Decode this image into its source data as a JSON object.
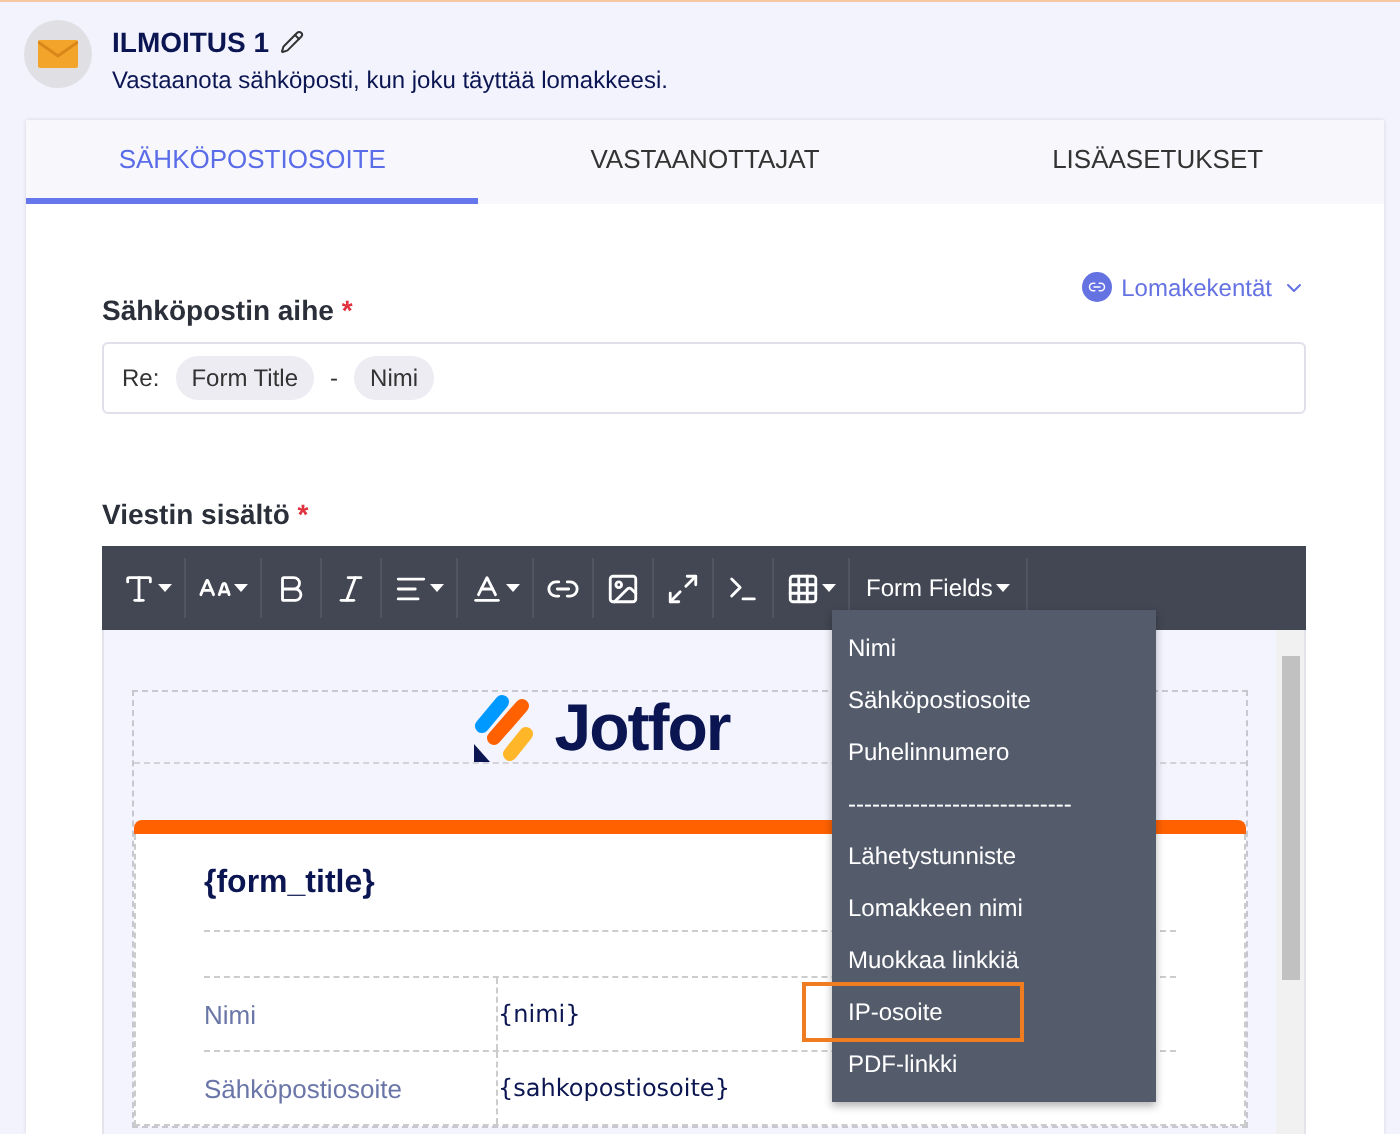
{
  "header": {
    "title": "ILMOITUS 1",
    "subtitle": "Vastaanota sähköposti, kun joku täyttää lomakkeesi."
  },
  "tabs": [
    {
      "label": "SÄHKÖPOSTIOSOITE",
      "selected": true
    },
    {
      "label": "VASTAANOTTAJAT",
      "selected": false
    },
    {
      "label": "LISÄASETUKSET",
      "selected": false
    }
  ],
  "subject": {
    "label": "Sähköpostin aihe",
    "required": "*",
    "fields_link": "Lomakekentät",
    "prefix": "Re:",
    "separator": "-",
    "tags": [
      "Form Title",
      "Nimi"
    ]
  },
  "message": {
    "label": "Viestin sisältö",
    "required": "*"
  },
  "toolbar": {
    "tools": [
      {
        "kind": "type",
        "caret": true
      },
      {
        "kind": "size",
        "caret": true
      },
      {
        "kind": "bold",
        "caret": false
      },
      {
        "kind": "italic",
        "caret": false
      },
      {
        "kind": "align",
        "caret": true
      },
      {
        "kind": "color",
        "caret": true
      },
      {
        "kind": "link",
        "caret": false
      },
      {
        "kind": "image",
        "caret": false
      },
      {
        "kind": "fullscreen",
        "caret": false
      },
      {
        "kind": "code",
        "caret": false
      },
      {
        "kind": "table",
        "caret": true
      }
    ],
    "form_fields": "Form Fields"
  },
  "form_fields_menu": [
    {
      "label": "Nimi",
      "highlighted": false
    },
    {
      "label": "Sähköpostiosoite",
      "highlighted": false
    },
    {
      "label": "Puhelinnumero",
      "highlighted": false
    },
    {
      "label": "----------------------------",
      "highlighted": false
    },
    {
      "label": "Lähetystunniste",
      "highlighted": false
    },
    {
      "label": "Lomakkeen nimi",
      "highlighted": false
    },
    {
      "label": "Muokkaa linkkiä",
      "highlighted": false
    },
    {
      "label": "IP-osoite",
      "highlighted": true
    },
    {
      "label": "PDF-linkki",
      "highlighted": false
    }
  ],
  "email_template": {
    "logo_text": "Jotfor",
    "form_title": "{form_title}",
    "rows": [
      {
        "label": "Nimi",
        "value": "{nimi}"
      },
      {
        "label": "Sähköpostiosoite",
        "value": "{sahkopostiosoite}"
      }
    ]
  }
}
